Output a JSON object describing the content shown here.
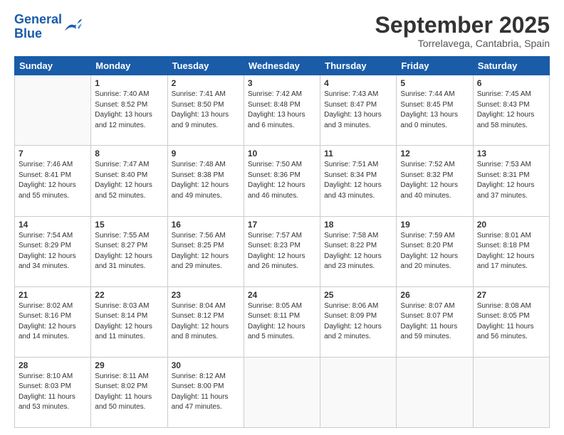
{
  "logo": {
    "line1": "General",
    "line2": "Blue"
  },
  "title": "September 2025",
  "location": "Torrelavega, Cantabria, Spain",
  "weekdays": [
    "Sunday",
    "Monday",
    "Tuesday",
    "Wednesday",
    "Thursday",
    "Friday",
    "Saturday"
  ],
  "weeks": [
    [
      {
        "day": "",
        "info": ""
      },
      {
        "day": "1",
        "info": "Sunrise: 7:40 AM\nSunset: 8:52 PM\nDaylight: 13 hours\nand 12 minutes."
      },
      {
        "day": "2",
        "info": "Sunrise: 7:41 AM\nSunset: 8:50 PM\nDaylight: 13 hours\nand 9 minutes."
      },
      {
        "day": "3",
        "info": "Sunrise: 7:42 AM\nSunset: 8:48 PM\nDaylight: 13 hours\nand 6 minutes."
      },
      {
        "day": "4",
        "info": "Sunrise: 7:43 AM\nSunset: 8:47 PM\nDaylight: 13 hours\nand 3 minutes."
      },
      {
        "day": "5",
        "info": "Sunrise: 7:44 AM\nSunset: 8:45 PM\nDaylight: 13 hours\nand 0 minutes."
      },
      {
        "day": "6",
        "info": "Sunrise: 7:45 AM\nSunset: 8:43 PM\nDaylight: 12 hours\nand 58 minutes."
      }
    ],
    [
      {
        "day": "7",
        "info": "Sunrise: 7:46 AM\nSunset: 8:41 PM\nDaylight: 12 hours\nand 55 minutes."
      },
      {
        "day": "8",
        "info": "Sunrise: 7:47 AM\nSunset: 8:40 PM\nDaylight: 12 hours\nand 52 minutes."
      },
      {
        "day": "9",
        "info": "Sunrise: 7:48 AM\nSunset: 8:38 PM\nDaylight: 12 hours\nand 49 minutes."
      },
      {
        "day": "10",
        "info": "Sunrise: 7:50 AM\nSunset: 8:36 PM\nDaylight: 12 hours\nand 46 minutes."
      },
      {
        "day": "11",
        "info": "Sunrise: 7:51 AM\nSunset: 8:34 PM\nDaylight: 12 hours\nand 43 minutes."
      },
      {
        "day": "12",
        "info": "Sunrise: 7:52 AM\nSunset: 8:32 PM\nDaylight: 12 hours\nand 40 minutes."
      },
      {
        "day": "13",
        "info": "Sunrise: 7:53 AM\nSunset: 8:31 PM\nDaylight: 12 hours\nand 37 minutes."
      }
    ],
    [
      {
        "day": "14",
        "info": "Sunrise: 7:54 AM\nSunset: 8:29 PM\nDaylight: 12 hours\nand 34 minutes."
      },
      {
        "day": "15",
        "info": "Sunrise: 7:55 AM\nSunset: 8:27 PM\nDaylight: 12 hours\nand 31 minutes."
      },
      {
        "day": "16",
        "info": "Sunrise: 7:56 AM\nSunset: 8:25 PM\nDaylight: 12 hours\nand 29 minutes."
      },
      {
        "day": "17",
        "info": "Sunrise: 7:57 AM\nSunset: 8:23 PM\nDaylight: 12 hours\nand 26 minutes."
      },
      {
        "day": "18",
        "info": "Sunrise: 7:58 AM\nSunset: 8:22 PM\nDaylight: 12 hours\nand 23 minutes."
      },
      {
        "day": "19",
        "info": "Sunrise: 7:59 AM\nSunset: 8:20 PM\nDaylight: 12 hours\nand 20 minutes."
      },
      {
        "day": "20",
        "info": "Sunrise: 8:01 AM\nSunset: 8:18 PM\nDaylight: 12 hours\nand 17 minutes."
      }
    ],
    [
      {
        "day": "21",
        "info": "Sunrise: 8:02 AM\nSunset: 8:16 PM\nDaylight: 12 hours\nand 14 minutes."
      },
      {
        "day": "22",
        "info": "Sunrise: 8:03 AM\nSunset: 8:14 PM\nDaylight: 12 hours\nand 11 minutes."
      },
      {
        "day": "23",
        "info": "Sunrise: 8:04 AM\nSunset: 8:12 PM\nDaylight: 12 hours\nand 8 minutes."
      },
      {
        "day": "24",
        "info": "Sunrise: 8:05 AM\nSunset: 8:11 PM\nDaylight: 12 hours\nand 5 minutes."
      },
      {
        "day": "25",
        "info": "Sunrise: 8:06 AM\nSunset: 8:09 PM\nDaylight: 12 hours\nand 2 minutes."
      },
      {
        "day": "26",
        "info": "Sunrise: 8:07 AM\nSunset: 8:07 PM\nDaylight: 11 hours\nand 59 minutes."
      },
      {
        "day": "27",
        "info": "Sunrise: 8:08 AM\nSunset: 8:05 PM\nDaylight: 11 hours\nand 56 minutes."
      }
    ],
    [
      {
        "day": "28",
        "info": "Sunrise: 8:10 AM\nSunset: 8:03 PM\nDaylight: 11 hours\nand 53 minutes."
      },
      {
        "day": "29",
        "info": "Sunrise: 8:11 AM\nSunset: 8:02 PM\nDaylight: 11 hours\nand 50 minutes."
      },
      {
        "day": "30",
        "info": "Sunrise: 8:12 AM\nSunset: 8:00 PM\nDaylight: 11 hours\nand 47 minutes."
      },
      {
        "day": "",
        "info": ""
      },
      {
        "day": "",
        "info": ""
      },
      {
        "day": "",
        "info": ""
      },
      {
        "day": "",
        "info": ""
      }
    ]
  ]
}
